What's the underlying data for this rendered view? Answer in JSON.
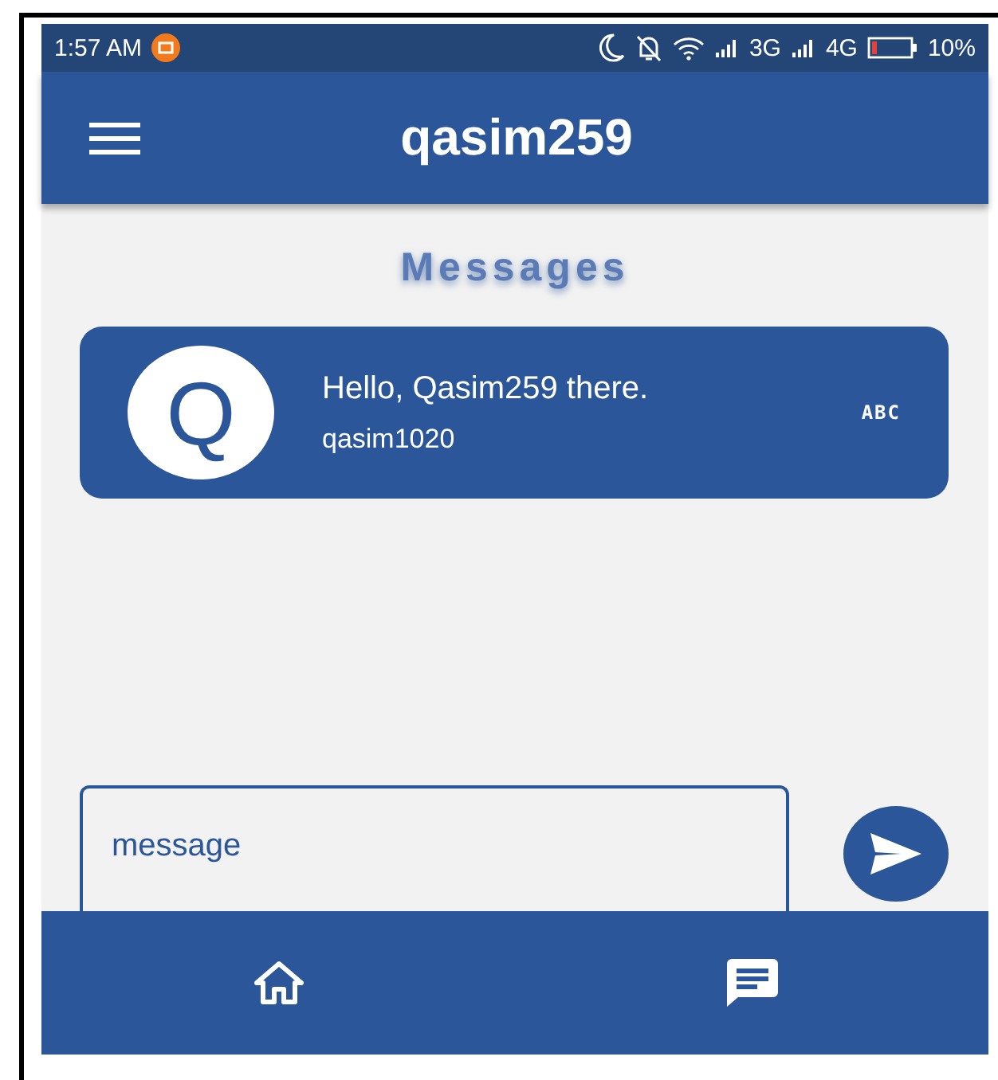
{
  "status_bar": {
    "time": "1:57 AM",
    "network_1": "3G",
    "network_2": "4G",
    "battery": "10%"
  },
  "app_bar": {
    "title": "qasim259"
  },
  "heading": "Messages",
  "messages": [
    {
      "avatar_letter": "Q",
      "text": "Hello, Qasim259 there.",
      "sender": "qasim1020",
      "tag": "ABC"
    }
  ],
  "composer": {
    "placeholder": "message"
  },
  "bottom_nav": [
    {
      "kind": "home"
    },
    {
      "kind": "chat"
    }
  ]
}
